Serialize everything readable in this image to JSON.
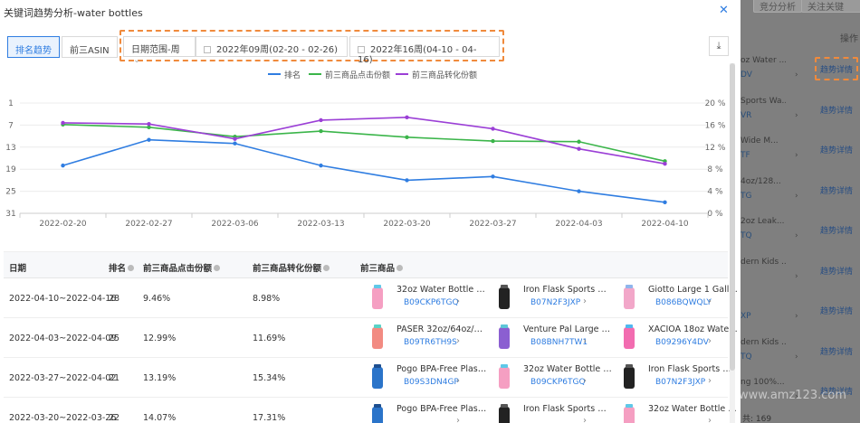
{
  "modal": {
    "title": "关键词趋势分析-water bottles",
    "close_icon": "close-icon",
    "tabs": [
      {
        "label": "排名趋势",
        "active": true
      },
      {
        "label": "前三ASIN",
        "active": false
      }
    ],
    "date_range_select": "日期范围-周",
    "start_week": "2022年09周(02-20 - 02-26)",
    "end_week": "2022年16周(04-10 - 04-16)",
    "download_icon": "download-icon"
  },
  "chart_data": {
    "type": "line",
    "x": [
      "2022-02-20",
      "2022-02-27",
      "2022-03-06",
      "2022-03-13",
      "2022-03-20",
      "2022-03-27",
      "2022-04-03",
      "2022-04-10"
    ],
    "left_axis": {
      "ticks": [
        "1",
        "7",
        "13",
        "19",
        "25",
        "31"
      ],
      "reversed": true,
      "range": [
        1,
        31
      ]
    },
    "right_axis": {
      "ticks": [
        "20 %",
        "16 %",
        "12 %",
        "8 %",
        "4 %",
        "0 %"
      ],
      "range": [
        0,
        20
      ]
    },
    "series": [
      {
        "name": "排名",
        "axis": "left",
        "color": "#2f7de1",
        "values": [
          18,
          11,
          12,
          18,
          22,
          21,
          25,
          28
        ]
      },
      {
        "name": "前三商品点击份额",
        "axis": "right",
        "color": "#3bb54a",
        "values": [
          16.1,
          15.6,
          13.9,
          14.9,
          13.8,
          13.1,
          12.99,
          9.46
        ]
      },
      {
        "name": "前三商品转化份额",
        "axis": "right",
        "color": "#9b3fd6",
        "values": [
          16.4,
          16.2,
          13.5,
          16.9,
          17.4,
          15.34,
          11.69,
          8.98
        ]
      }
    ]
  },
  "table": {
    "headers": [
      "日期",
      "排名",
      "前三商品点击份额",
      "前三商品转化份额",
      "前三商品"
    ],
    "rows": [
      {
        "date": "2022-04-10~2022-04-16",
        "rank": "28",
        "click": "9.46%",
        "conv": "8.98%",
        "products": [
          {
            "title": "32oz Water Bottle wi...",
            "asin": "B09CKP6TGQ",
            "thumb": "pink-bottle"
          },
          {
            "title": "Iron Flask Sports Wa...",
            "asin": "B07N2F3JXP",
            "thumb": "black-bottle"
          },
          {
            "title": "Giotto Large 1 Gallo...",
            "asin": "B086BQWQLY",
            "thumb": "multi-bottle"
          }
        ]
      },
      {
        "date": "2022-04-03~2022-04-09",
        "rank": "25",
        "click": "12.99%",
        "conv": "11.69%",
        "products": [
          {
            "title": "PASER 32oz/64oz/12...",
            "asin": "B09TR6TH9S",
            "thumb": "coral-bottle"
          },
          {
            "title": "Venture Pal Large 1 ...",
            "asin": "B08BNH7TW1",
            "thumb": "purple-bottle"
          },
          {
            "title": "XACIOA 18oz Water ...",
            "asin": "B09296Y4DV",
            "thumb": "rainbow-bottles"
          }
        ]
      },
      {
        "date": "2022-03-27~2022-04-02",
        "rank": "21",
        "click": "13.19%",
        "conv": "15.34%",
        "products": [
          {
            "title": "Pogo BPA-Free Plast...",
            "asin": "B09S3DN4GP",
            "thumb": "blue-bottle"
          },
          {
            "title": "32oz Water Bottle wi...",
            "asin": "B09CKP6TGQ",
            "thumb": "pink-bottle"
          },
          {
            "title": "Iron Flask Sports Wa...",
            "asin": "B07N2F3JXP",
            "thumb": "black-bottle"
          }
        ]
      },
      {
        "date": "2022-03-20~2022-03-26",
        "rank": "22",
        "click": "14.07%",
        "conv": "17.31%",
        "products": [
          {
            "title": "Pogo BPA-Free Plast...",
            "asin": "",
            "thumb": "blue-bottle"
          },
          {
            "title": "Iron Flask Sports Wa...",
            "asin": "",
            "thumb": "black-bottle"
          },
          {
            "title": "32oz Water Bottle wi...",
            "asin": "",
            "thumb": "pink-bottle"
          }
        ]
      }
    ]
  },
  "background": {
    "top_buttons": [
      "竞分分析",
      "关注关键"
    ],
    "op_header": "操作",
    "rows": [
      {
        "title": "oz Water ...",
        "asin": "DV",
        "link": "趋势详情"
      },
      {
        "title": "Sports Wa...",
        "asin": "VR",
        "link": "趋势详情"
      },
      {
        "title": "Wide M...",
        "asin": "TF",
        "link": "趋势详情"
      },
      {
        "title": "4oz/128...",
        "asin": "TG",
        "link": "趋势详情"
      },
      {
        "title": "2oz Leak...",
        "asin": "TQ",
        "link": "趋势详情"
      },
      {
        "title": "dern Kids ...",
        "asin": "",
        "link": "趋势详情"
      },
      {
        "title": "",
        "asin": "XP",
        "link": "趋势详情"
      },
      {
        "title": "dern Kids ...",
        "asin": "TQ",
        "link": "趋势详情"
      },
      {
        "title": "ng 100%...",
        "asin": "",
        "link": "趋势详情"
      }
    ],
    "bottom_text": "共: 169",
    "watermark": "www.amz123.com"
  }
}
